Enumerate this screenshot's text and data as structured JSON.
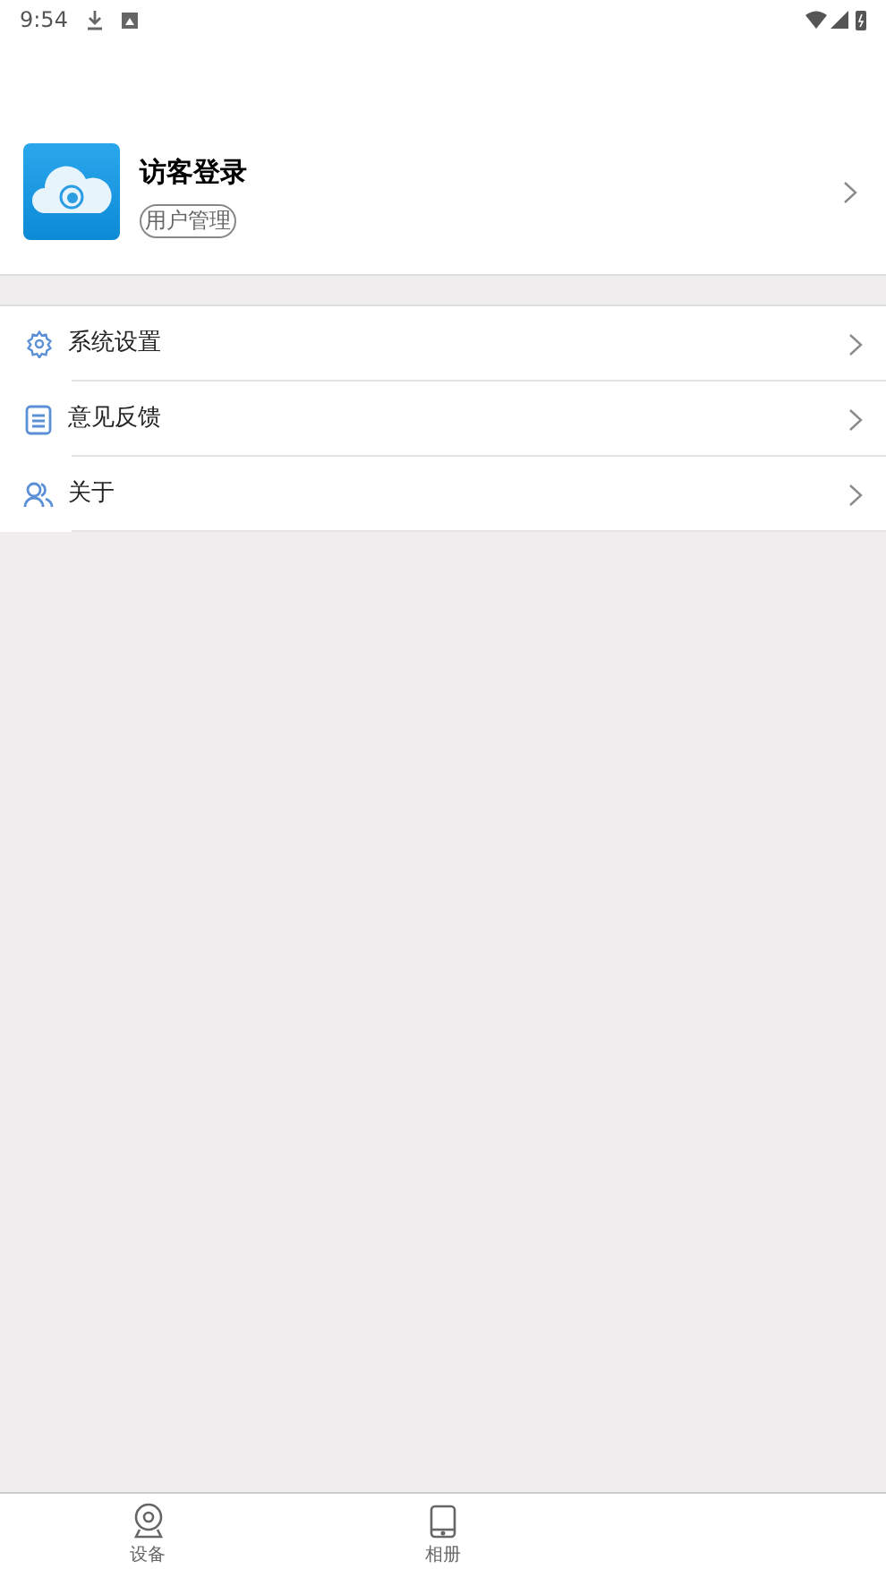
{
  "status_bar": {
    "time": "9:54"
  },
  "profile": {
    "name": "访客登录",
    "tag": "用户管理"
  },
  "menu": [
    {
      "kind": "settings",
      "label": "系统设置"
    },
    {
      "kind": "feedback",
      "label": "意见反馈"
    },
    {
      "kind": "about",
      "label": "关于"
    }
  ],
  "bottom_nav": [
    {
      "kind": "device",
      "label": "设备",
      "selected": false
    },
    {
      "kind": "album",
      "label": "相册",
      "selected": false
    }
  ]
}
